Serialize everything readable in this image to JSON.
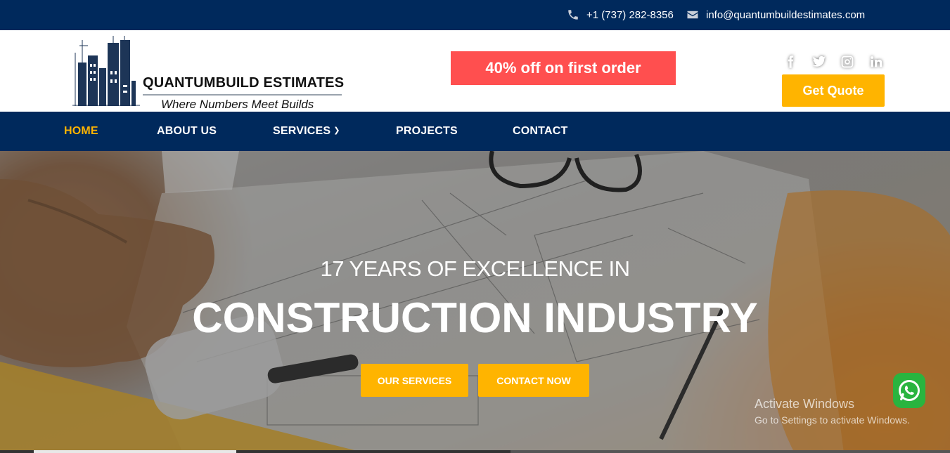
{
  "topbar": {
    "phone": "+1 (737) 282-8356",
    "email": "info@quantumbuildestimates.com",
    "phone_icon": "phone-icon",
    "email_icon": "envelope-icon"
  },
  "header": {
    "brand_name": "QUANTUMBUILD ESTIMATES",
    "tagline": "Where Numbers Meet Builds",
    "promo": "40% off on first order",
    "quote_button": "Get Quote",
    "socials": [
      "facebook-icon",
      "twitter-icon",
      "instagram-icon",
      "linkedin-icon"
    ]
  },
  "nav": {
    "items": [
      {
        "label": "HOME",
        "active": true
      },
      {
        "label": "ABOUT US"
      },
      {
        "label": "SERVICES"
      },
      {
        "label": "PROJECTS"
      },
      {
        "label": "CONTACT"
      }
    ]
  },
  "hero": {
    "line1": "17 YEARS OF EXCELLENCE IN",
    "line2": "CONSTRUCTION INDUSTRY",
    "buttons": [
      "OUR SERVICES",
      "CONTACT NOW"
    ]
  },
  "overlay": {
    "activate_title": "Activate Windows",
    "activate_sub": "Go to Settings to activate Windows."
  },
  "colors": {
    "navy": "#00295c",
    "accent": "#ffb400",
    "promo": "#ff4f4f",
    "whatsapp": "#29b43f"
  }
}
